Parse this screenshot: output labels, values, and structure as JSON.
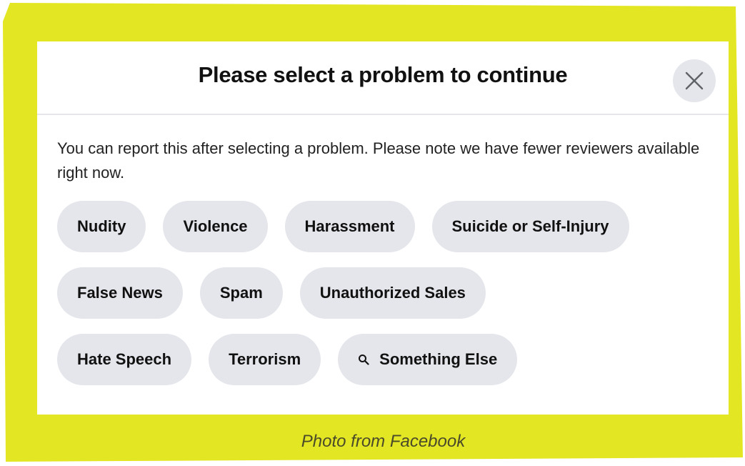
{
  "colors": {
    "frame_yellow": "#e3e622",
    "dialog_bg": "#ffffff",
    "chip_bg": "#e4e6eb",
    "divider": "#e6e7ea"
  },
  "dialog": {
    "title": "Please select a problem to continue",
    "close_icon": "close-icon",
    "note": "You can report this after selecting a problem. Please note we have fewer reviewers available right now.",
    "chip_rows": [
      [
        "Nudity",
        "Violence",
        "Harassment",
        "Suicide or Self-Injury"
      ],
      [
        "False News",
        "Spam",
        "Unauthorized Sales"
      ],
      [
        "Hate Speech",
        "Terrorism",
        "Something Else"
      ]
    ],
    "something_else_icon": "search-icon"
  },
  "caption": "Photo from Facebook"
}
